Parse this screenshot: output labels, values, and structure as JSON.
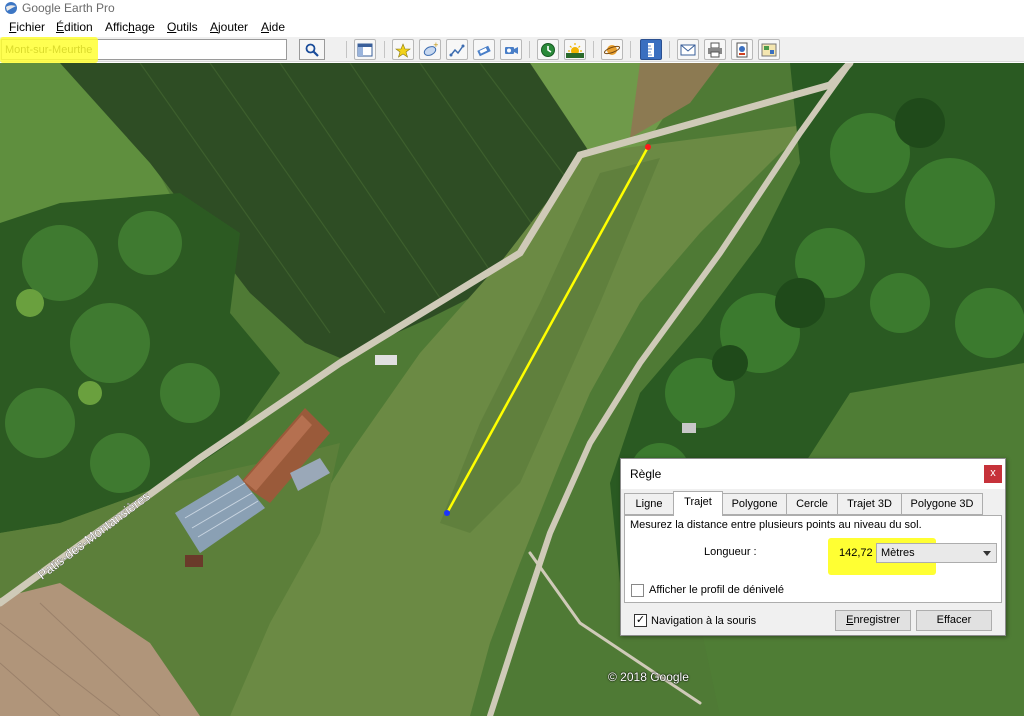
{
  "window": {
    "title": "Google Earth Pro"
  },
  "menu": [
    {
      "pre": "",
      "u": "F",
      "post": "ichier"
    },
    {
      "pre": "",
      "u": "É",
      "post": "dition"
    },
    {
      "pre": "Affic",
      "u": "h",
      "post": "age"
    },
    {
      "pre": "",
      "u": "O",
      "post": "utils"
    },
    {
      "pre": "",
      "u": "A",
      "post": "jouter"
    },
    {
      "pre": "",
      "u": "A",
      "post": "ide"
    }
  ],
  "search": {
    "value": "Mont-sur-Meurthe"
  },
  "toolbar": {
    "buttons": [
      "sidebar-icon",
      "add-placemark-icon",
      "add-polygon-icon",
      "add-path-icon",
      "add-image-overlay-icon",
      "record-tour-icon",
      "historical-imagery-icon",
      "sunlight-icon",
      "planets-icon",
      "ruler-icon",
      "email-icon",
      "print-icon",
      "save-image-icon",
      "view-in-maps-icon"
    ]
  },
  "map": {
    "road_label": "Patis-des-Montansières",
    "copyright": "© 2018 Google",
    "measurement_line_color": "#ffff00",
    "start_point_color": "#ff1a1a",
    "end_point_color": "#1a33ff"
  },
  "ruler": {
    "title": "Règle",
    "close": "x",
    "tabs": [
      "Ligne",
      "Trajet",
      "Polygone",
      "Cercle",
      "Trajet 3D",
      "Polygone 3D"
    ],
    "active_tab": "Trajet",
    "description": "Mesurez la distance entre plusieurs points au niveau du sol.",
    "length_label": "Longueur :",
    "length_value": "142,72",
    "unit": "Mètres",
    "show_elevation_profile": {
      "label": "Afficher le profil de dénivelé",
      "checked": false
    },
    "mouse_navigation": {
      "label": "Navigation à la souris",
      "checked": true,
      "mark": "✓"
    },
    "save_button": {
      "pre": "",
      "u": "E",
      "post": "nregistrer"
    },
    "clear_button": "Effacer"
  }
}
